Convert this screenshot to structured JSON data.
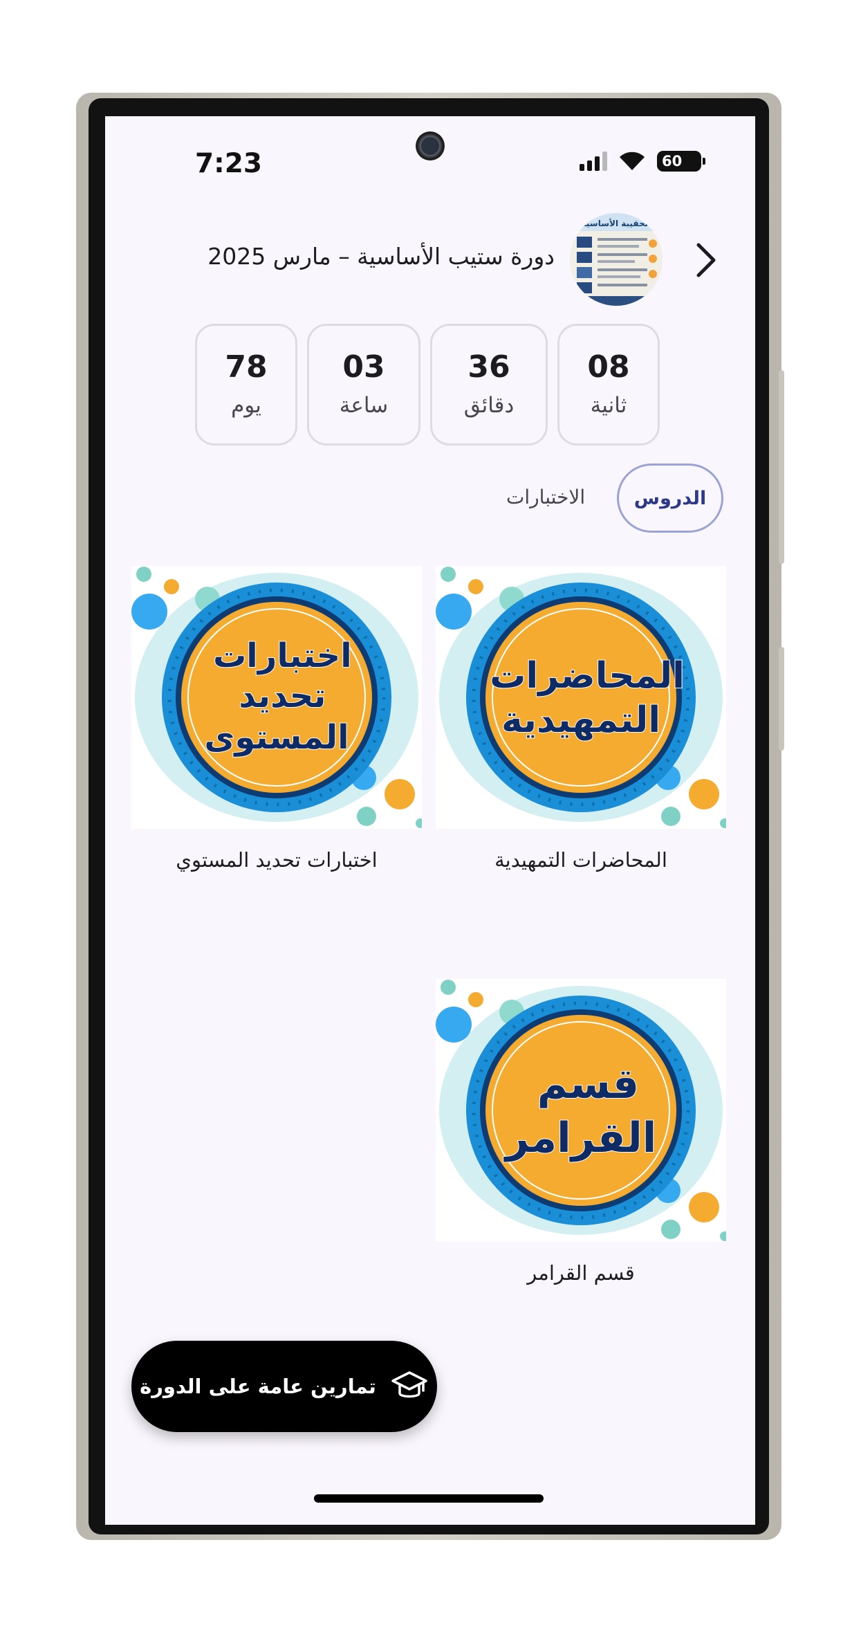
{
  "status_bar": {
    "time": "7:23",
    "battery": "60"
  },
  "header": {
    "course_title": "دورة ستيب الأساسية – مارس 2025",
    "thumbnail_icon": "course-thumbnail",
    "thumbnail_text": "الحقيبة الأساسية",
    "back_icon": "chevron-right-icon"
  },
  "countdown": [
    {
      "value": "08",
      "label": "ثانية"
    },
    {
      "value": "36",
      "label": "دقائق"
    },
    {
      "value": "03",
      "label": "ساعة"
    },
    {
      "value": "78",
      "label": "يوم"
    }
  ],
  "tabs": {
    "active": "الدروس",
    "other": "الاختبارات"
  },
  "cards": [
    {
      "title": "المحاضرات التمهيدية",
      "image_lines": [
        "المحاضرات",
        "التمهيدية"
      ]
    },
    {
      "title": "اختبارات تحديد المستوي",
      "image_lines": [
        "اختبارات",
        "تحديد",
        "المستوى"
      ]
    },
    {
      "title": "قسم القرامر",
      "image_lines": [
        "قسم",
        "القرامر"
      ]
    }
  ],
  "fab": {
    "label": "تمارين عامة على الدورة",
    "icon": "graduation-cap-icon"
  },
  "colors": {
    "accent": "#2d3a8c",
    "badge_orange": "#f5ab2f",
    "badge_blue": "#1a8fd8",
    "text_navy": "#0f2b66"
  }
}
